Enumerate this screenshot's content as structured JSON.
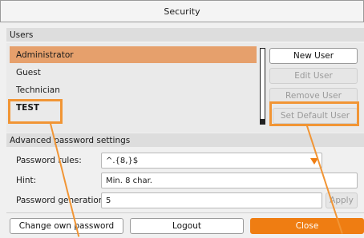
{
  "window": {
    "title": "Security"
  },
  "users": {
    "heading": "Users",
    "items": [
      {
        "label": "Administrator",
        "state": "selected"
      },
      {
        "label": "Guest",
        "state": "normal"
      },
      {
        "label": "Technician",
        "state": "normal"
      },
      {
        "label": "TEST",
        "state": "highlighted"
      }
    ],
    "buttons": {
      "new_user": "New User",
      "edit_user": "Edit User",
      "remove_user": "Remove User",
      "set_default_user": "Set Default User"
    }
  },
  "advanced": {
    "heading": "Advanced password settings",
    "password_rules_label": "Password rules:",
    "password_rules_value": "^.{8,}$",
    "hint_label": "Hint:",
    "hint_value": "Min. 8 char.",
    "generations_label": "Password generations:",
    "generations_value": "5",
    "apply_label": "Apply"
  },
  "footer": {
    "change_password": "Change own password",
    "logout": "Logout",
    "close": "Close"
  },
  "colors": {
    "accent": "#ef7d12",
    "selection": "#e6a06c",
    "highlight": "#f19535"
  }
}
